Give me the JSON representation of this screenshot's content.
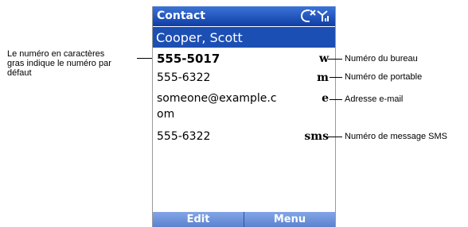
{
  "titlebar": {
    "title": "Contact"
  },
  "status": {
    "icon": "signal-status-icon"
  },
  "contact": {
    "name": "Cooper, Scott"
  },
  "numbers": [
    {
      "value": "555-5017",
      "type": "w",
      "default": true
    },
    {
      "value": "555-6322",
      "type": "m"
    },
    {
      "value_line1": "someone@example.c",
      "value_line2": "om",
      "type": "e"
    },
    {
      "value": "555-6322",
      "type": "sms"
    }
  ],
  "softkeys": {
    "left": "Edit",
    "right": "Menu"
  },
  "callouts": {
    "default_note": [
      "Le numéro en caractères",
      "gras indique le numéro par",
      "défaut"
    ],
    "work": "Numéro du bureau",
    "mobile": "Numéro de portable",
    "email": "Adresse e-mail",
    "sms": "Numéro de message SMS"
  },
  "colors": {
    "titlebar": "#1c4fb3",
    "softkeys": "#6a8fd8"
  }
}
